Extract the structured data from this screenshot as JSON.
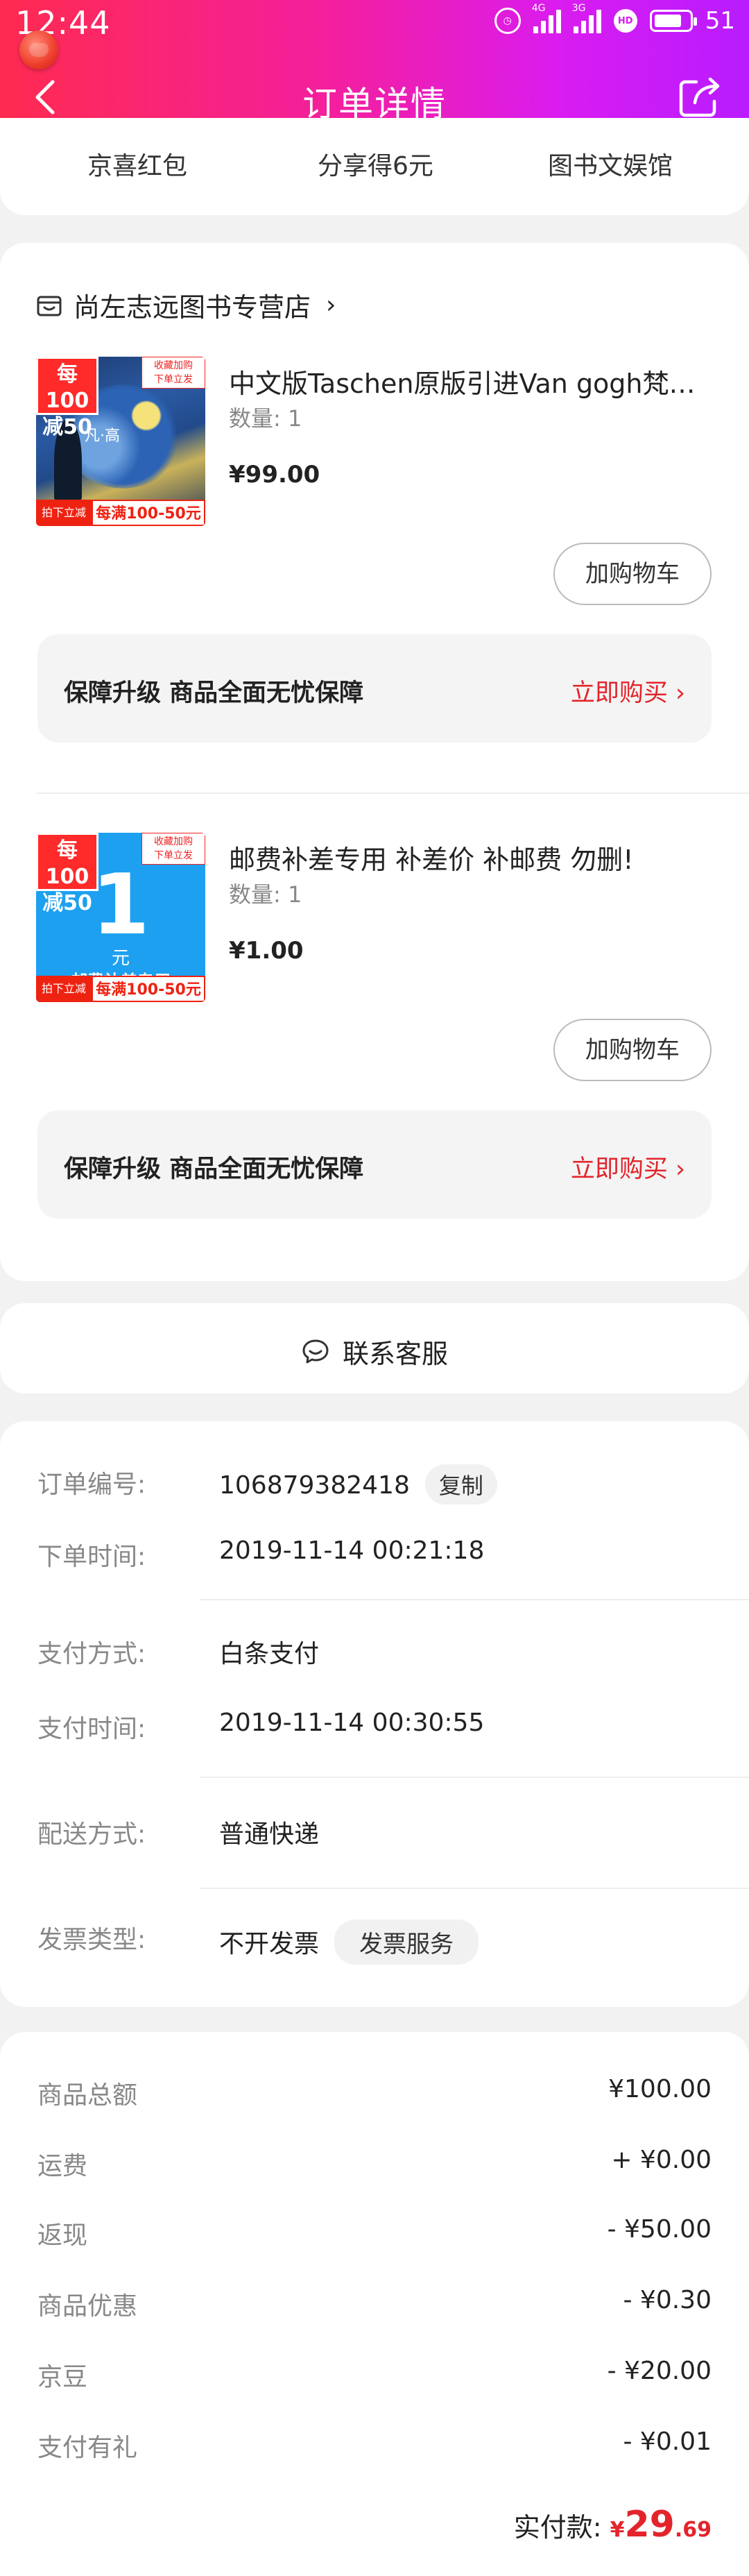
{
  "status_bar": {
    "time": "12:44",
    "network1": "4G",
    "network2": "3G",
    "battery": "51"
  },
  "nav": {
    "title": "订单详情"
  },
  "tabs": [
    "京喜红包",
    "分享得6元",
    "图书文娱馆"
  ],
  "shop": {
    "name": "尚左志远图书专营店"
  },
  "products": [
    {
      "title": "中文版Taschen原版引进Van gogh梵…",
      "qty": "数量: 1",
      "price": "¥99.00",
      "thumb": {
        "tag": "每100\n减50",
        "corner": "收藏加购\n下单立发",
        "foot_left": "拍下立减",
        "foot_right": "每满100-50元",
        "cover_title": "凡·高"
      },
      "cart_label": "加购物车",
      "guard_title": "保障升级  商品全面无忧保障",
      "guard_action": "立即购买"
    },
    {
      "title": "邮费补差专用 补差价  补邮费   勿删!",
      "qty": "数量: 1",
      "price": "¥1.00",
      "thumb": {
        "tag": "每100\n减50",
        "corner": "收藏加购\n下单立发",
        "foot_left": "拍下立减",
        "foot_right": "每满100-50元",
        "big": "1",
        "unit": "元",
        "text": "邮费补差专用"
      },
      "cart_label": "加购物车",
      "guard_title": "保障升级  商品全面无忧保障",
      "guard_action": "立即购买"
    }
  ],
  "service": {
    "label": "联系客服"
  },
  "order_info": {
    "order_no_label": "订单编号:",
    "order_no": "106879382418",
    "copy": "复制",
    "order_time_label": "下单时间:",
    "order_time": "2019-11-14 00:21:18",
    "pay_method_label": "支付方式:",
    "pay_method": "白条支付",
    "pay_time_label": "支付时间:",
    "pay_time": "2019-11-14 00:30:55",
    "delivery_label": "配送方式:",
    "delivery": "普通快递",
    "invoice_label": "发票类型:",
    "invoice": "不开发票",
    "invoice_service": "发票服务"
  },
  "fees": [
    {
      "label": "商品总额",
      "value": "¥100.00"
    },
    {
      "label": "运费",
      "value": "+ ¥0.00"
    },
    {
      "label": "返现",
      "value": "- ¥50.00"
    },
    {
      "label": "商品优惠",
      "value": "- ¥0.30"
    },
    {
      "label": "京豆",
      "value": "- ¥20.00"
    },
    {
      "label": "支付有礼",
      "value": "- ¥0.01"
    }
  ],
  "total": {
    "label": "实付款:",
    "currency": "¥",
    "integer": "29",
    "decimal": ".69"
  },
  "colors": {
    "accent": "#e3242b",
    "header_start": "#ff2a4f",
    "header_end": "#b81cff"
  }
}
